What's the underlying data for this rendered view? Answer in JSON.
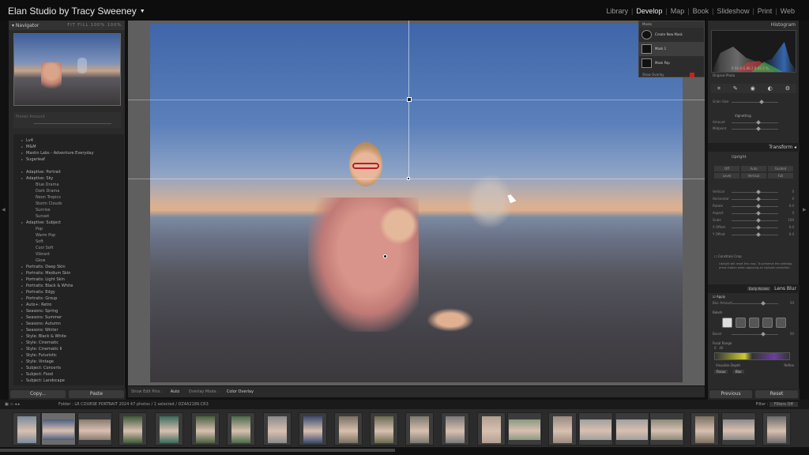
{
  "app": {
    "identity": "Elan Studio by Tracy Sweeney"
  },
  "modules": [
    "Library",
    "Develop",
    "Map",
    "Book",
    "Slideshow",
    "Print",
    "Web"
  ],
  "active_module": "Develop",
  "left_panel": {
    "navigator_title": "Navigator",
    "navigator_options": "FIT  FILL  100%  100%",
    "preset_amount_label": "Preset Amount",
    "preset_groups": [
      {
        "label": "Lv4",
        "level": 1
      },
      {
        "label": "M&M",
        "level": 1
      },
      {
        "label": "Mastin Labs - Adventure Everyday",
        "level": 1
      },
      {
        "label": "Sugarleaf",
        "level": 1
      },
      {
        "label": "",
        "level": 0
      },
      {
        "label": "Adaptive: Portrait",
        "level": 1
      },
      {
        "label": "Adaptive: Sky",
        "level": 1
      },
      {
        "label": "Blue Drama",
        "level": 2
      },
      {
        "label": "Dark Drama",
        "level": 2
      },
      {
        "label": "Neon Tropics",
        "level": 2
      },
      {
        "label": "Storm Clouds",
        "level": 2
      },
      {
        "label": "Sunrise",
        "level": 2
      },
      {
        "label": "Sunset",
        "level": 2
      },
      {
        "label": "Adaptive: Subject",
        "level": 1
      },
      {
        "label": "Pop",
        "level": 2
      },
      {
        "label": "Warm Pop",
        "level": 2
      },
      {
        "label": "Soft",
        "level": 2
      },
      {
        "label": "Cool Soft",
        "level": 2
      },
      {
        "label": "Vibrant",
        "level": 2
      },
      {
        "label": "Glow",
        "level": 2
      },
      {
        "label": "Portraits: Deep Skin",
        "level": 1
      },
      {
        "label": "Portraits: Medium Skin",
        "level": 1
      },
      {
        "label": "Portraits: Light Skin",
        "level": 1
      },
      {
        "label": "Portraits: Black & White",
        "level": 1
      },
      {
        "label": "Portraits: Edgy",
        "level": 1
      },
      {
        "label": "Portraits: Group",
        "level": 1
      },
      {
        "label": "Auto+: Retro",
        "level": 1
      },
      {
        "label": "Seasons: Spring",
        "level": 1
      },
      {
        "label": "Seasons: Summer",
        "level": 1
      },
      {
        "label": "Seasons: Autumn",
        "level": 1
      },
      {
        "label": "Seasons: Winter",
        "level": 1
      },
      {
        "label": "Style: Black & White",
        "level": 1
      },
      {
        "label": "Style: Cinematic",
        "level": 1
      },
      {
        "label": "Style: Cinematic II",
        "level": 1
      },
      {
        "label": "Style: Futuristic",
        "level": 1
      },
      {
        "label": "Style: Vintage",
        "level": 1
      },
      {
        "label": "Subject: Concerts",
        "level": 1
      },
      {
        "label": "Subject: Food",
        "level": 1
      },
      {
        "label": "Subject: Landscape",
        "level": 1
      }
    ],
    "copy_label": "Copy...",
    "paste_label": "Paste"
  },
  "toolbar": {
    "show_edit_pins_label": "Show Edit Pins :",
    "show_edit_pins_value": "Auto",
    "overlay_mode_label": "Overlay Mode :",
    "overlay_mode_value": "Color Overlay"
  },
  "masks": {
    "title": "Masks",
    "create_label": "Create New Mask",
    "items": [
      "Mask 1",
      "Mask Pop"
    ],
    "show_overlay_label": "Show Overlay",
    "overlay_color": "#d02020"
  },
  "right_panel": {
    "histogram_title": "Histogram",
    "histogram_values": "R  91.6   G  88.2   B  80.3 %",
    "original_photo_label": "Original Photo",
    "effects_labels": [
      "Grain Size",
      "Vignetting",
      "Amount",
      "Midpoint"
    ],
    "transform_title": "Transform",
    "upright_label": "Upright",
    "upright_buttons": [
      "Off",
      "Auto",
      "Guided",
      "Level",
      "Vertical",
      "Full"
    ],
    "transform_sliders": [
      "Vertical",
      "Horizontal",
      "Rotate",
      "Aspect",
      "Scale",
      "X Offset",
      "Y Offset"
    ],
    "transform_values": [
      "0",
      "0",
      "0.0",
      "0",
      "100",
      "0.0",
      "0.0"
    ],
    "constrain_crop_label": "Constrain Crop",
    "upright_note": "Upright will reset the crop. To preserve the settings, press Option when applying an Upright correction.",
    "early_access_label": "Early Access",
    "lens_blur_title": "Lens Blur",
    "apply_label": "Apply",
    "blur_amount_label": "Blur Amount",
    "blur_amount_value": "50",
    "bokeh_label": "Bokeh",
    "boost_label": "Boost",
    "boost_value": "50",
    "focal_range_label": "Focal Range",
    "focal_range_values": "0   40",
    "visualize_depth_label": "Visualize Depth",
    "refine_label": "Refine",
    "focus_label": "Focus",
    "blur_label": "Blur",
    "previous_label": "Previous",
    "reset_label": "Reset"
  },
  "filmstrip": {
    "source": "Folder : LR COURSE PORTRAIT 2024   47 photos / 1 selected / DZ4A2189.CR3",
    "filter_label": "Filter :",
    "filter_value": "Filters Off",
    "thumbnail_count": 22,
    "selected_index": 1
  }
}
